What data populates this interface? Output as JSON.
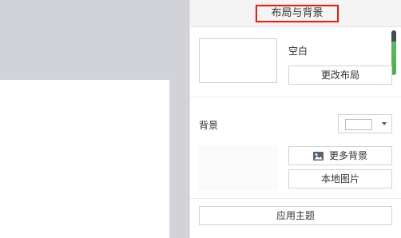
{
  "panel": {
    "title": "布局与背景",
    "layout": {
      "current_name": "空白",
      "change_button": "更改布局"
    },
    "background": {
      "label": "背景",
      "selected_color": "#ffffff",
      "more_button": "更多背景",
      "local_image_button": "本地图片"
    },
    "apply_button": "应用主题"
  },
  "icons": {
    "more_background": "image-icon",
    "color_dropdown": "chevron-down-icon"
  },
  "colors": {
    "highlight_border": "#d9241c",
    "scrollbar_thumb": "#4fae50"
  }
}
